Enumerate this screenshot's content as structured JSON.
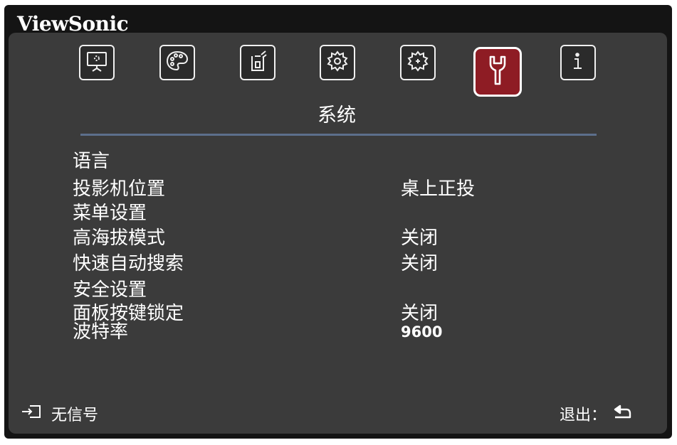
{
  "brand": "ViewSonic",
  "tabs": [
    {
      "icon": "picture-icon",
      "active": false
    },
    {
      "icon": "color-palette-icon",
      "active": false
    },
    {
      "icon": "power-management-icon",
      "active": false
    },
    {
      "icon": "basic-settings-gear-icon",
      "active": false
    },
    {
      "icon": "advanced-settings-gear-icon",
      "active": false
    },
    {
      "icon": "wrench-icon",
      "active": true
    },
    {
      "icon": "info-icon",
      "active": false
    }
  ],
  "section_title": "系统",
  "rows": [
    {
      "label": "语言",
      "value": ""
    },
    {
      "label": "投影机位置",
      "value": "桌上正投"
    },
    {
      "label": "菜单设置",
      "value": ""
    },
    {
      "label": "高海拔模式",
      "value": "关闭"
    },
    {
      "label": "快速自动搜索",
      "value": "关闭"
    },
    {
      "label": "安全设置",
      "value": ""
    },
    {
      "label": "面板按键锁定",
      "value": "关闭"
    },
    {
      "label": "波特率",
      "value": "9600"
    }
  ],
  "footer": {
    "source_icon": "input-source-icon",
    "source_status": "无信号",
    "exit_label": "退出：",
    "exit_icon": "back-arrow-icon"
  },
  "colors": {
    "frame": "#141414",
    "panel": "#3b3b3b",
    "active_tab": "#8e1c24",
    "divider": "#5c6f8c",
    "text": "#ffffff"
  }
}
